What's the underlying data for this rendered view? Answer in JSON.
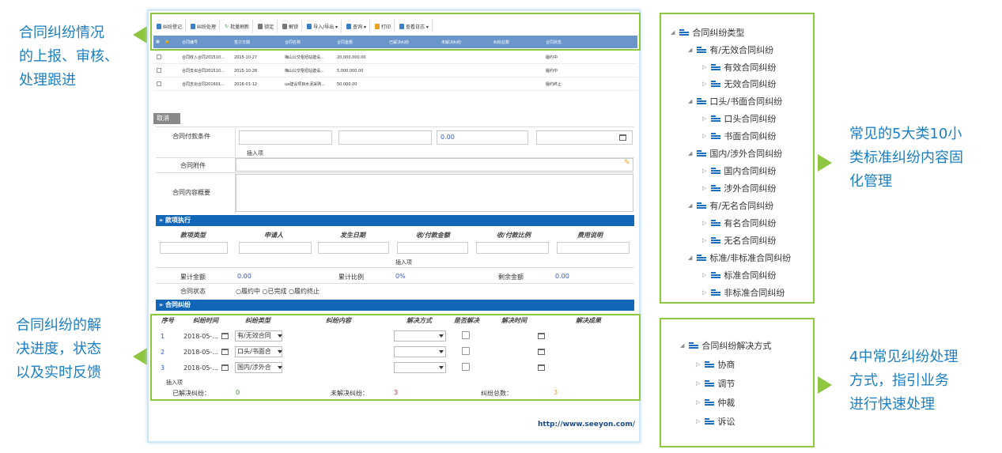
{
  "callouts": {
    "top_left": [
      "合同纠纷情况",
      "的上报、审核、",
      "处理跟进"
    ],
    "bottom_left": [
      "合同纠纷的解",
      "决进度，状态",
      "以及实时反馈"
    ],
    "top_right": [
      "常见的5大类10小",
      "类标准纠纷内容固",
      "化管理"
    ],
    "bottom_right": [
      "4中常见纠纷处理",
      "方式，指引业务",
      "进行快速处理"
    ]
  },
  "toolbar": [
    "纠纷登记",
    "纠纷处理",
    "批量刷新",
    "锁定",
    "解锁",
    "导入/导出 ▾",
    "查询 ▾",
    "打印",
    "查看日志 ▾"
  ],
  "grid": {
    "headers": [
      "合同编号",
      "签订日期",
      "合同名称",
      "合同金额",
      "已解决纠纷",
      "未解决纠纷",
      "纠纷总数",
      "合同状态"
    ],
    "rows": [
      [
        "合同收入合同201510...",
        "2015-10-27",
        "梅山公交枢纽站建设...",
        "20,000,000.00",
        "履约中"
      ],
      [
        "合同支出合同201510...",
        "2015-10-28",
        "梅山公交枢纽站建设...",
        "5,000,000.00",
        "履约中"
      ],
      [
        "合同支出合同201601...",
        "2016-01-12",
        "ua建设项目水泥采购...",
        "50,000.00",
        "履约终止"
      ]
    ]
  },
  "cancel_label": "取消",
  "form": {
    "payment_terms_label": "合同付款条件",
    "payment_value": "0.00",
    "insert_item": "插入项",
    "attachment_label": "合同附件",
    "summary_label": "合同内容概要",
    "payment_section": "款项执行",
    "payment_columns": [
      "款项类型",
      "申请人",
      "发生日期",
      "收/付款金额",
      "收/付款比例",
      "费用说明"
    ],
    "total_amount_label": "累计金额",
    "total_amount": "0.00",
    "total_ratio_label": "累计比例",
    "total_ratio": "0%",
    "remaining_label": "剩余金额",
    "remaining": "0.00",
    "status_label": "合同状态",
    "status_options": [
      "履约中",
      "已完成",
      "履约终止"
    ],
    "dispute_section": "合同纠纷",
    "dispute_columns": [
      "序号",
      "纠纷时间",
      "纠纷类型",
      "纠纷内容",
      "解决方式",
      "是否解决",
      "解决时间",
      "解决成果"
    ],
    "dispute_rows": [
      {
        "no": "1",
        "date": "2018-05-...",
        "type": "有/无效合同"
      },
      {
        "no": "2",
        "date": "2018-05-...",
        "type": "口头/书面合"
      },
      {
        "no": "3",
        "date": "2018-05-...",
        "type": "国内/涉外合"
      }
    ],
    "resolved_label": "已解决纠纷：",
    "resolved": "0",
    "unresolved_label": "未解决纠纷：",
    "unresolved": "3",
    "total_label": "纠纷总数：",
    "total": "3",
    "url": "http://www.seeyon.com/"
  },
  "tree_types": {
    "root": "合同纠纷类型",
    "groups": [
      {
        "name": "有/无效合同纠纷",
        "children": [
          "有效合同纠纷",
          "无效合同纠纷"
        ]
      },
      {
        "name": "口头/书面合同纠纷",
        "children": [
          "口头合同纠纷",
          "书面合同纠纷"
        ]
      },
      {
        "name": "国内/涉外合同纠纷",
        "children": [
          "国内合同纠纷",
          "涉外合同纠纷"
        ]
      },
      {
        "name": "有/无名合同纠纷",
        "children": [
          "有名合同纠纷",
          "无名合同纠纷"
        ]
      },
      {
        "name": "标准/非标准合同纠纷",
        "children": [
          "标准合同纠纷",
          "非标准合同纠纷"
        ]
      }
    ]
  },
  "tree_methods": {
    "root": "合同纠纷解决方式",
    "children": [
      "协商",
      "调节",
      "仲裁",
      "诉讼"
    ]
  }
}
